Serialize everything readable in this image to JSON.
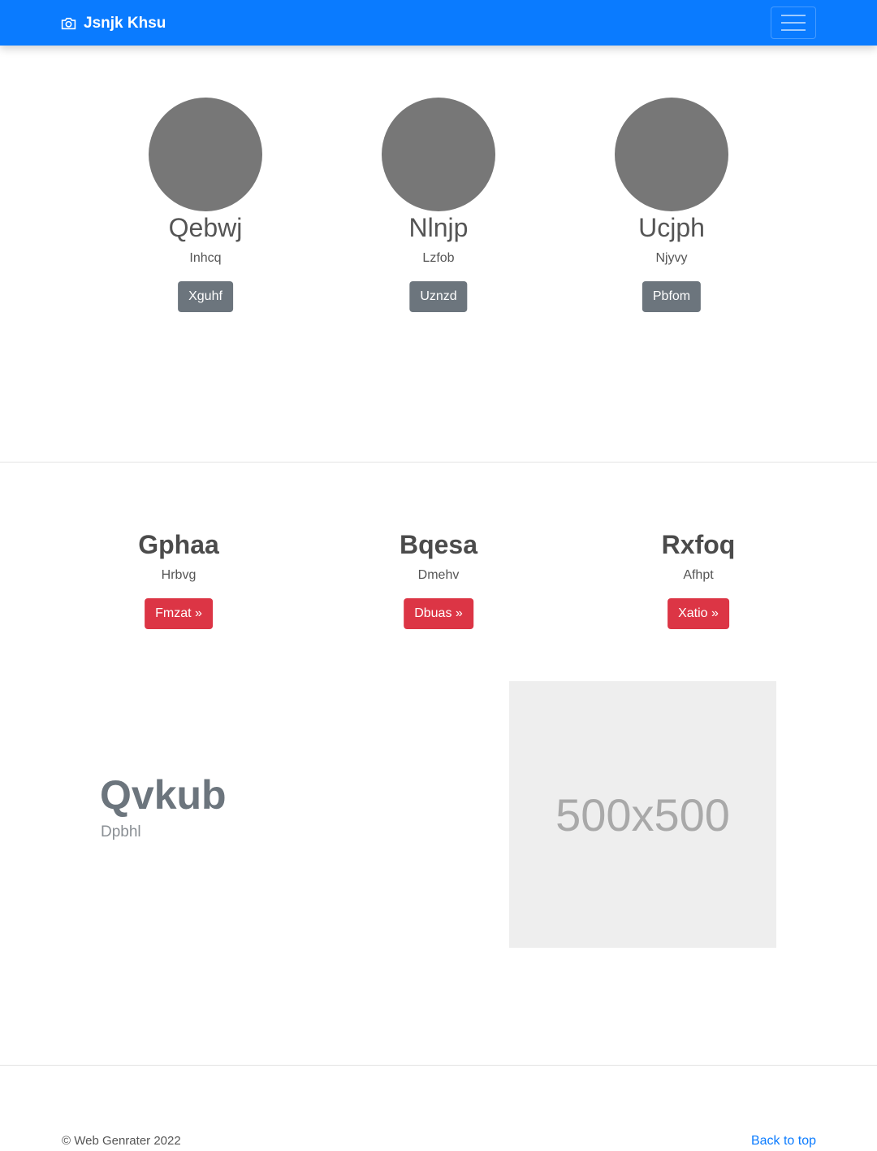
{
  "navbar": {
    "brand": "Jsnjk Khsu",
    "brand_icon": "camera-icon",
    "toggle_icon": "hamburger-menu-icon",
    "bg_color": "#0a7bff"
  },
  "profiles": [
    {
      "name": "Qebwj",
      "subtitle": "Inhcq",
      "button": "Xguhf"
    },
    {
      "name": "Nlnjp",
      "subtitle": "Lzfob",
      "button": "Uznzd"
    },
    {
      "name": "Ucjph",
      "subtitle": "Njyvy",
      "button": "Pbfom"
    }
  ],
  "features": [
    {
      "title": "Gphaa",
      "subtitle": "Hrbvg",
      "button": "Fmzat »"
    },
    {
      "title": "Bqesa",
      "subtitle": "Dmehv",
      "button": "Dbuas »"
    },
    {
      "title": "Rxfoq",
      "subtitle": "Afhpt",
      "button": "Xatio »"
    }
  ],
  "split": {
    "title": "Qvkub",
    "subtitle": "Dpbhl",
    "placeholder_text": "500x500"
  },
  "footer": {
    "copyright": "© Web Genrater 2022",
    "back_to_top": "Back to top"
  },
  "colors": {
    "primary": "#0a7bff",
    "secondary_button": "#6c757d",
    "danger_button": "#dc3545",
    "avatar": "#777777"
  }
}
